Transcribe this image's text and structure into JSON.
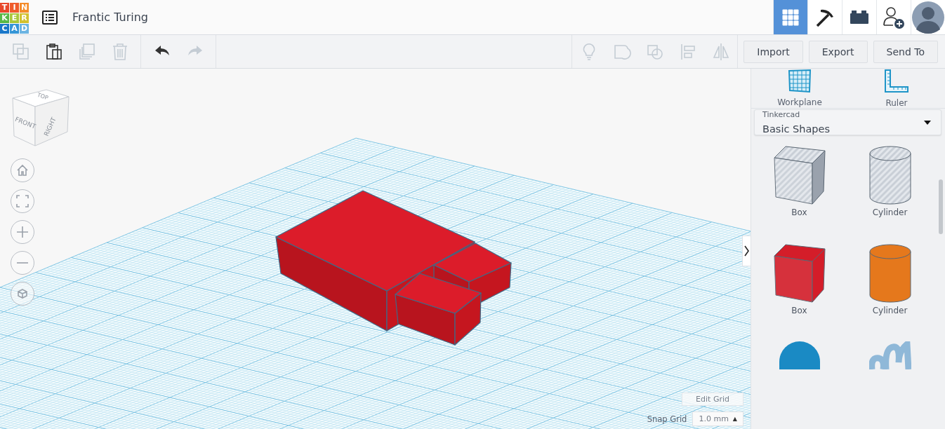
{
  "logo": [
    {
      "letter": "T",
      "color": "#e8472b"
    },
    {
      "letter": "I",
      "color": "#ef5b2b"
    },
    {
      "letter": "N",
      "color": "#f48c2a"
    },
    {
      "letter": "K",
      "color": "#58b847"
    },
    {
      "letter": "E",
      "color": "#a9c73a"
    },
    {
      "letter": "R",
      "color": "#d2c12f"
    },
    {
      "letter": "C",
      "color": "#1a77c9"
    },
    {
      "letter": "A",
      "color": "#3595d6"
    },
    {
      "letter": "D",
      "color": "#6cb4e2"
    }
  ],
  "design_title": "Frantic Turing",
  "nav": [
    {
      "kind": "grid",
      "selected": true
    },
    {
      "kind": "pickaxe",
      "selected": false
    },
    {
      "kind": "bricks",
      "selected": false
    },
    {
      "kind": "invite"
    },
    {
      "kind": "avatar"
    }
  ],
  "edit_tools": [
    {
      "kind": "copy",
      "disabled": true
    },
    {
      "kind": "paste",
      "disabled": false
    },
    {
      "kind": "duplicate",
      "disabled": true
    },
    {
      "kind": "delete",
      "disabled": true
    }
  ],
  "history_tools": [
    {
      "kind": "undo",
      "disabled": false
    },
    {
      "kind": "redo",
      "disabled": true
    }
  ],
  "shape_tools": [
    {
      "kind": "note",
      "disabled": true
    },
    {
      "kind": "group",
      "disabled": true
    },
    {
      "kind": "ungroup",
      "disabled": true
    },
    {
      "kind": "align",
      "disabled": true
    },
    {
      "kind": "mirror",
      "disabled": true
    }
  ],
  "actions": [
    "Import",
    "Export",
    "Send To"
  ],
  "view_cube": {
    "top": "TOP",
    "front": "FRONT",
    "right": "RIGHT"
  },
  "view_controls": [
    {
      "kind": "home"
    },
    {
      "kind": "fit"
    },
    {
      "kind": "zoom-in"
    },
    {
      "kind": "zoom-out"
    },
    {
      "kind": "perspective"
    }
  ],
  "edit_grid": "Edit Grid",
  "snap_grid": {
    "label": "Snap Grid",
    "value": "1.0 mm",
    "caret": "▲"
  },
  "panel_tools": [
    {
      "kind": "workplane",
      "label": "Workplane"
    },
    {
      "kind": "ruler",
      "label": "Ruler"
    }
  ],
  "library": {
    "source": "Tinkercad",
    "value": "Basic Shapes"
  },
  "shapes": [
    {
      "kind": "box",
      "hole": true,
      "label": "Box"
    },
    {
      "kind": "cylinder",
      "hole": true,
      "label": "Cylinder"
    },
    {
      "kind": "box",
      "hole": false,
      "color": "#d41d29",
      "label": "Box"
    },
    {
      "kind": "cylinder",
      "hole": false,
      "color": "#e5781c",
      "label": "Cylinder"
    },
    {
      "kind": "sphere",
      "color": "#1a8ac4"
    },
    {
      "kind": "scribble",
      "color": "#8fb8d8"
    }
  ]
}
